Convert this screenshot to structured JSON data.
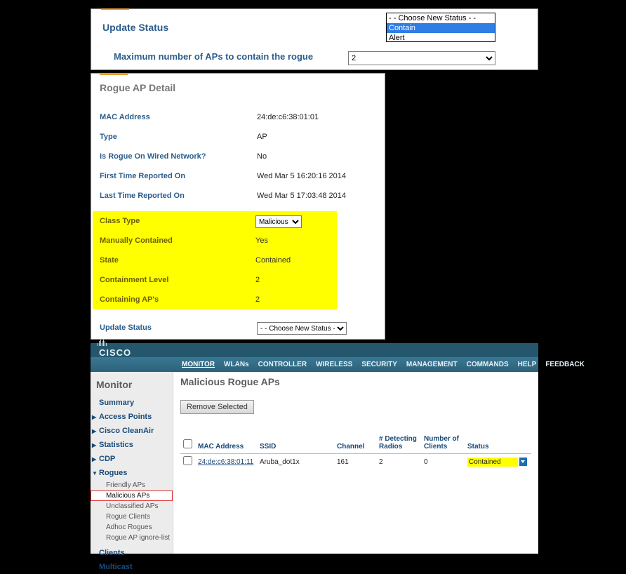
{
  "top": {
    "title": "Update Status",
    "status_options": [
      "- - Choose New Status - -",
      "Contain",
      "Alert"
    ],
    "status_selected_index": 1,
    "max_ap_label": "Maximum number of APs to contain the rogue",
    "max_ap_value": "2"
  },
  "detail": {
    "title": "Rogue AP Detail",
    "rows": {
      "mac_label": "MAC Address",
      "mac_value": "24:de:c6:38:01:01",
      "type_label": "Type",
      "type_value": "AP",
      "wired_label": "Is Rogue On Wired Network?",
      "wired_value": "No",
      "first_label": "First Time Reported On",
      "first_value": "Wed Mar  5 16:20:16 2014",
      "last_label": "Last Time Reported On",
      "last_value": "Wed Mar  5 17:03:48 2014"
    },
    "hl": {
      "class_label": "Class Type",
      "class_value": "Malicious",
      "manual_label": "Manually Contained",
      "manual_value": "Yes",
      "state_label": "State",
      "state_value": "Contained",
      "level_label": "Containment Level",
      "level_value": "2",
      "caps_label": "Containing AP's",
      "caps_value": "2"
    },
    "update_label": "Update Status",
    "update_value": "- - Choose New Status - -"
  },
  "wlc": {
    "brand": "CISCO",
    "menu": [
      "MONITOR",
      "WLANs",
      "CONTROLLER",
      "WIRELESS",
      "SECURITY",
      "MANAGEMENT",
      "COMMANDS",
      "HELP",
      "FEEDBACK"
    ],
    "menu_active": 0,
    "side_title": "Monitor",
    "side_items": [
      "Summary",
      "Access Points",
      "Cisco CleanAir",
      "Statistics",
      "CDP",
      "Rogues"
    ],
    "rogue_subs": [
      "Friendly APs",
      "Malicious APs",
      "Unclassified APs",
      "Rogue Clients",
      "Adhoc Rogues",
      "Rogue AP ignore-list"
    ],
    "rogue_selected_sub": 1,
    "side_items_tail": [
      "Clients",
      "Multicast"
    ],
    "main_title": "Malicious Rogue APs",
    "remove_label": "Remove Selected",
    "table": {
      "headers": [
        "MAC Address",
        "SSID",
        "Channel",
        "# Detecting Radios",
        "Number of Clients",
        "Status"
      ],
      "rows": [
        {
          "mac": "24:de:c6:38:01:11",
          "ssid": "Aruba_dot1x",
          "channel": "161",
          "radios": "2",
          "clients": "0",
          "status": "Contained"
        }
      ]
    }
  }
}
